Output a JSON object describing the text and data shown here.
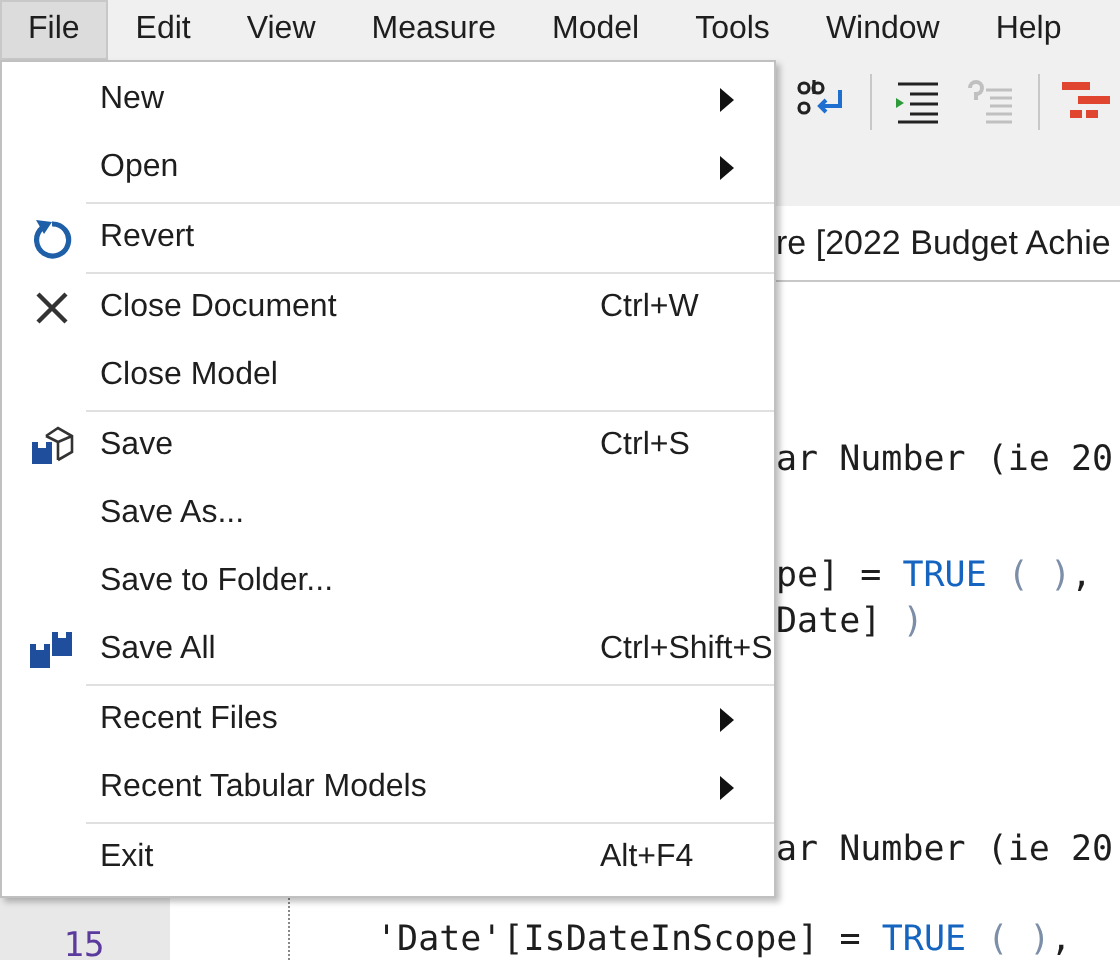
{
  "menubar": [
    {
      "label": "File",
      "selected": true
    },
    {
      "label": "Edit",
      "selected": false
    },
    {
      "label": "View",
      "selected": false
    },
    {
      "label": "Measure",
      "selected": false
    },
    {
      "label": "Model",
      "selected": false
    },
    {
      "label": "Tools",
      "selected": false
    },
    {
      "label": "Window",
      "selected": false
    },
    {
      "label": "Help",
      "selected": false
    }
  ],
  "toolbar": [
    {
      "kind": "wrap",
      "disabled": false
    },
    {
      "kind": "separator"
    },
    {
      "kind": "indent",
      "disabled": false
    },
    {
      "kind": "comment",
      "disabled": true
    },
    {
      "kind": "separator"
    },
    {
      "kind": "bars",
      "disabled": false
    }
  ],
  "header": {
    "text": "re [",
    "link": "2022 Budget Achie"
  },
  "code_lines": [
    {
      "covered": true,
      "segments": [
        {
          "kind": "plain",
          "text": "ar Number (ie 20"
        }
      ]
    },
    {
      "covered": true,
      "segments": [
        {
          "kind": "plain",
          "text": "pe] = "
        },
        {
          "kind": "keyword",
          "text": "TRUE"
        },
        {
          "kind": "paren",
          "text": " ( )"
        },
        {
          "kind": "plain",
          "text": ","
        }
      ]
    },
    {
      "covered": true,
      "segments": [
        {
          "kind": "plain",
          "text": "Date] "
        },
        {
          "kind": "paren",
          "text": ")"
        }
      ]
    },
    {
      "covered": true,
      "segments": [
        {
          "kind": "plain",
          "text": "ar Number (ie 20"
        }
      ]
    },
    {
      "covered": false,
      "line_number": "15",
      "segments": [
        {
          "kind": "plain",
          "text": "'Date'[IsDateInScope] = "
        },
        {
          "kind": "keyword",
          "text": "TRUE"
        },
        {
          "kind": "paren",
          "text": " ( )"
        },
        {
          "kind": "plain",
          "text": ","
        }
      ]
    }
  ],
  "file_menu": [
    [
      {
        "label": "New",
        "submenu": true
      },
      {
        "label": "Open",
        "submenu": true
      }
    ],
    [
      {
        "label": "Revert",
        "kind": "revert"
      }
    ],
    [
      {
        "label": "Close Document",
        "kind": "close",
        "shortcut": "Ctrl+W"
      },
      {
        "label": "Close Model"
      }
    ],
    [
      {
        "label": "Save",
        "kind": "save",
        "shortcut": "Ctrl+S"
      },
      {
        "label": "Save As..."
      },
      {
        "label": "Save to Folder..."
      },
      {
        "label": "Save All",
        "kind": "saveall",
        "shortcut": "Ctrl+Shift+S"
      }
    ],
    [
      {
        "label": "Recent Files",
        "submenu": true
      },
      {
        "label": "Recent Tabular Models",
        "submenu": true
      }
    ],
    [
      {
        "label": "Exit",
        "shortcut": "Alt+F4"
      }
    ]
  ]
}
